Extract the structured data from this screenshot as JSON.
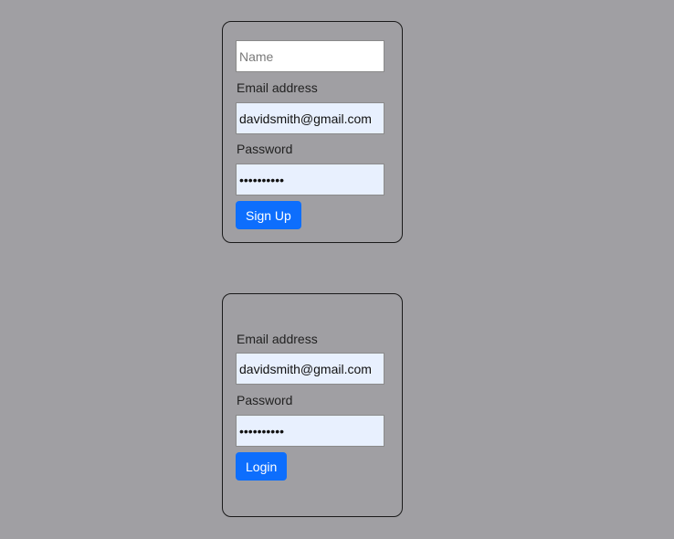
{
  "signup": {
    "name_placeholder": "Name",
    "name_value": "",
    "email_label": "Email address",
    "email_value": "davidsmith@gmail.com",
    "password_label": "Password",
    "password_value": "••••••••••",
    "submit_label": "Sign Up"
  },
  "login": {
    "email_label": "Email address",
    "email_value": "davidsmith@gmail.com",
    "password_label": "Password",
    "password_value": "••••••••••",
    "submit_label": "Login"
  },
  "colors": {
    "background": "#a09fa3",
    "button": "#0d6efd",
    "autofill": "#e8f0fe"
  }
}
